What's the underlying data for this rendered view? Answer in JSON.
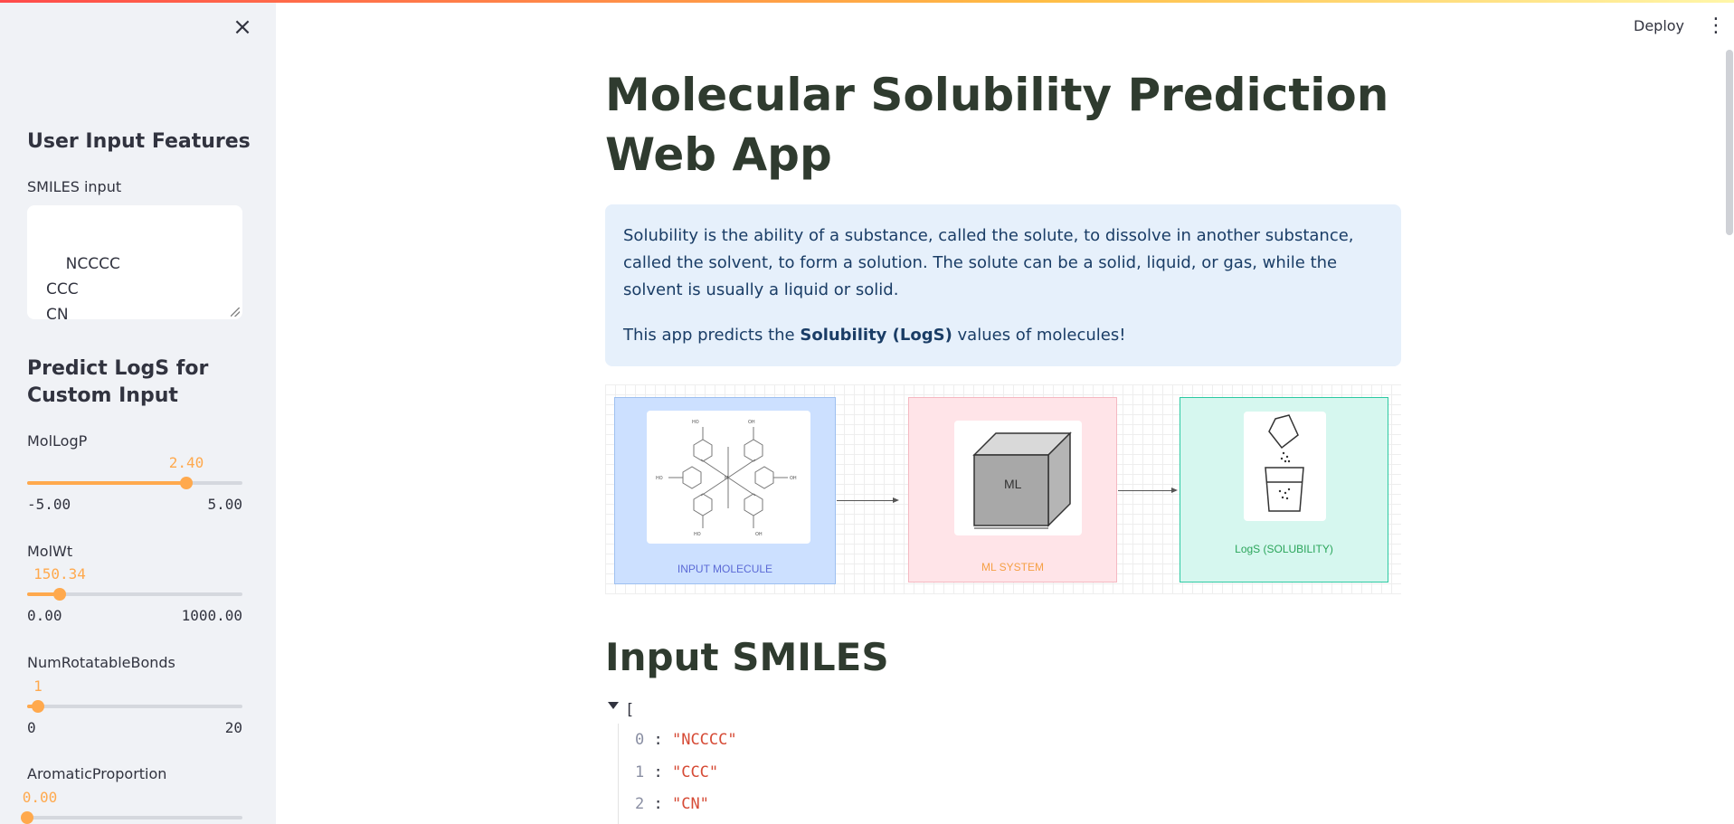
{
  "sidebar": {
    "close_icon": "close-icon",
    "user_input_heading": "User Input Features",
    "smiles_label": "SMILES input",
    "smiles_value": "NCCCC\nCCC\nCN",
    "predict_heading": "Predict LogS for Custom Input",
    "sliders": [
      {
        "label": "MolLogP",
        "value": "2.40",
        "min": "-5.00",
        "max": "5.00",
        "fraction": 0.74
      },
      {
        "label": "MolWt",
        "value": "150.34",
        "min": "0.00",
        "max": "1000.00",
        "fraction": 0.15
      },
      {
        "label": "NumRotatableBonds",
        "value": "1",
        "min": "0",
        "max": "20",
        "fraction": 0.05
      },
      {
        "label": "AromaticProportion",
        "value": "0.00",
        "min": "",
        "max": "",
        "fraction": 0.0
      }
    ]
  },
  "header": {
    "deploy_label": "Deploy",
    "menu_icon": "kebab-menu-icon"
  },
  "main": {
    "title": "Molecular Solubility Prediction Web App",
    "info_p1": "Solubility is the ability of a substance, called the solute, to dissolve in another substance, called the solvent, to form a solution. The solute can be a solid, liquid, or gas, while the solvent is usually a liquid or solid.",
    "info_p2_pre": "This app predicts the ",
    "info_p2_bold": "Solubility (LogS)",
    "info_p2_post": " values of molecules!",
    "diagram": {
      "input_caption": "INPUT MOLECULE",
      "ml_caption": "ML SYSTEM",
      "ml_cube_text": "ML",
      "output_caption": "LogS (SOLUBILITY)"
    },
    "input_smiles_heading": "Input SMILES",
    "json_open": "[",
    "json_items": [
      {
        "index": "0",
        "value": "\"NCCCC\""
      },
      {
        "index": "1",
        "value": "\"CCC\""
      },
      {
        "index": "2",
        "value": "\"CN\""
      }
    ]
  },
  "colors": {
    "accent": "#ffa94d",
    "info_bg": "#e6f0fb",
    "input_box": "#cce0ff",
    "ml_box": "#ffe4e8",
    "output_box": "#d6f7ef"
  }
}
